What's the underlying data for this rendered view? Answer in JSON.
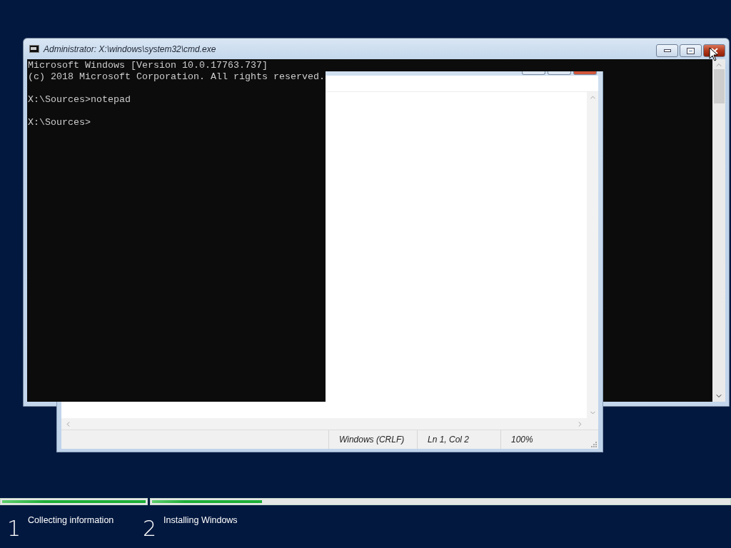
{
  "cmd_window": {
    "title": "Administrator: X:\\windows\\system32\\cmd.exe",
    "console_blocks": [
      [
        "Microsoft Windows [Version 10.0.17763.737]",
        "(c) 2018 Microsoft Corporation. All rights reserved."
      ],
      [
        "X:\\Sources>notepad"
      ],
      [
        "X:\\Sources>"
      ]
    ]
  },
  "notepad_window": {
    "status_bar": [
      "Windows (CRLF)",
      "Ln 1, Col 2",
      "100%"
    ]
  },
  "setup_progress": [
    {
      "number": "1",
      "label": "Collecting information",
      "level": 1
    },
    {
      "number": "2",
      "label": "Installing Windows",
      "level": 0.19
    }
  ]
}
